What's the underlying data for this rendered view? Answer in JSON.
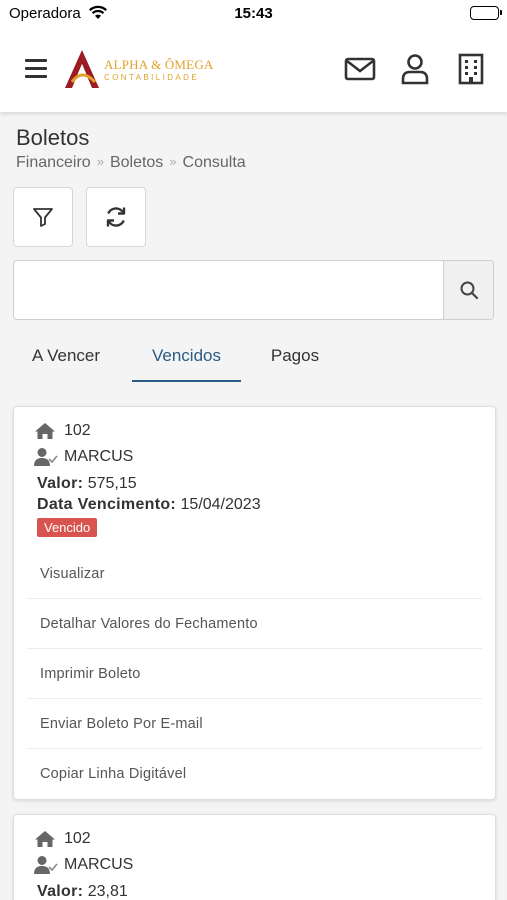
{
  "status_bar": {
    "carrier": "Operadora",
    "time": "15:43"
  },
  "header": {
    "logo_title": "ALPHA & ÔMEGA",
    "logo_subtitle": "CONTABILIDADE",
    "icons": [
      "menu-icon",
      "mail-icon",
      "user-icon",
      "building-icon"
    ]
  },
  "page": {
    "title": "Boletos",
    "breadcrumb": [
      "Financeiro",
      "Boletos",
      "Consulta"
    ],
    "breadcrumb_separator": "»"
  },
  "search": {
    "value": "",
    "placeholder": ""
  },
  "tabs": [
    {
      "label": "A Vencer",
      "active": false
    },
    {
      "label": "Vencidos",
      "active": true
    },
    {
      "label": "Pagos",
      "active": false
    }
  ],
  "cards": [
    {
      "unit": "102",
      "name": "MARCUS",
      "valor_label": "Valor:",
      "valor": "575,15",
      "vencimento_label": "Data Vencimento:",
      "vencimento": "15/04/2023",
      "status": "Vencido",
      "actions": [
        "Visualizar",
        "Detalhar Valores do Fechamento",
        "Imprimir Boleto",
        "Enviar Boleto Por E-mail",
        "Copiar Linha Digitável"
      ]
    },
    {
      "unit": "102",
      "name": "MARCUS",
      "valor_label": "Valor:",
      "valor": "23,81"
    }
  ],
  "colors": {
    "accent": "#2a5b84",
    "badge": "#d9534f",
    "logo_gold": "#e0a22a",
    "logo_red": "#9b1c22"
  }
}
